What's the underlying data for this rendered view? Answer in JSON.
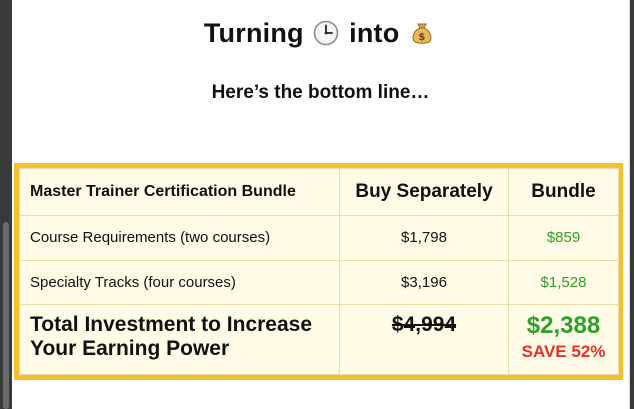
{
  "header": {
    "title_left": "Turning",
    "title_icon1": "clock-icon",
    "title_middle": "into",
    "title_icon2": "money-bag-icon",
    "subtitle": "Here’s the bottom line…"
  },
  "pricing_table": {
    "headers": [
      "Master Trainer Certification Bundle",
      "Buy Separately",
      "Bundle"
    ],
    "rows": [
      {
        "label": "Course Requirements (two courses)",
        "separate": "$1,798",
        "bundle": "$859"
      },
      {
        "label": "Specialty Tracks (four courses)",
        "separate": "$3,196",
        "bundle": "$1,528"
      }
    ],
    "total": {
      "label": "Total Investment to Increase Your Earning Power",
      "separate": "$4,994",
      "bundle": "$2,388",
      "savings": "SAVE 52%"
    }
  },
  "colors": {
    "border": "#f2c12e",
    "table_bg": "#fffbe6",
    "bundle_price": "#2ba12b",
    "savings": "#e2342a"
  }
}
